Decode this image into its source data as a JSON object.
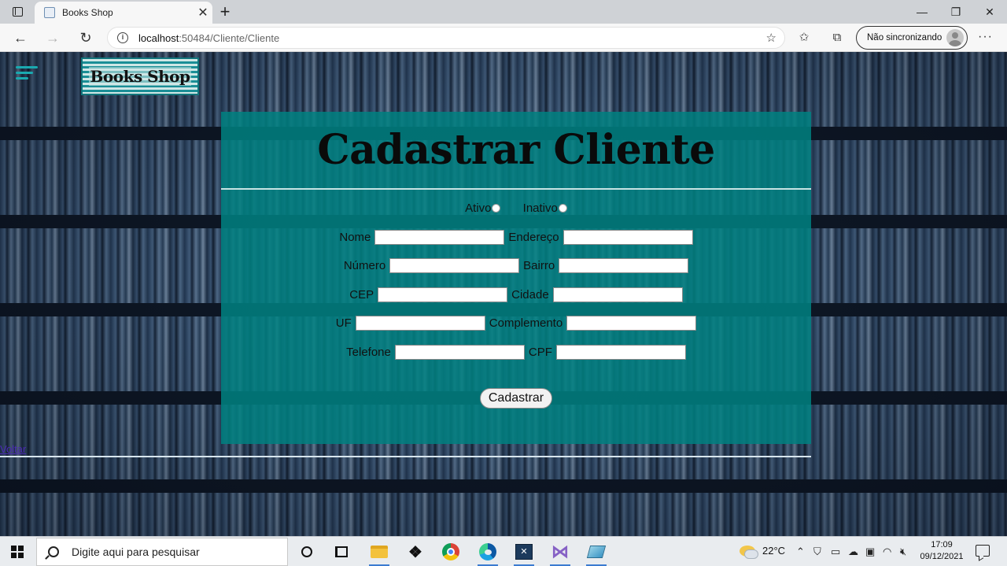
{
  "browser": {
    "tab_title": "Books Shop",
    "url_host": "localhost",
    "url_path": ":50484/Cliente/Cliente",
    "profile_label": "Não sincronizando"
  },
  "page": {
    "logo_text": "Books Shop",
    "form_title": "Cadastrar Cliente",
    "status": {
      "active_label": "Ativo",
      "inactive_label": "Inativo"
    },
    "fields": {
      "nome": "Nome",
      "endereco": "Endereço",
      "numero": "Número",
      "bairro": "Bairro",
      "cep": "CEP",
      "cidade": "Cidade",
      "uf": "UF",
      "complemento": "Complemento",
      "telefone": "Telefone",
      "cpf": "CPF"
    },
    "submit_label": "Cadastrar",
    "back_link": "Voltar"
  },
  "taskbar": {
    "search_placeholder": "Digite aqui para pesquisar",
    "weather": "22°C",
    "time": "17:09",
    "date": "09/12/2021"
  },
  "colors": {
    "form_background": "#008080",
    "logo_accent": "#1a8e96",
    "link": "#4b2ab5"
  }
}
